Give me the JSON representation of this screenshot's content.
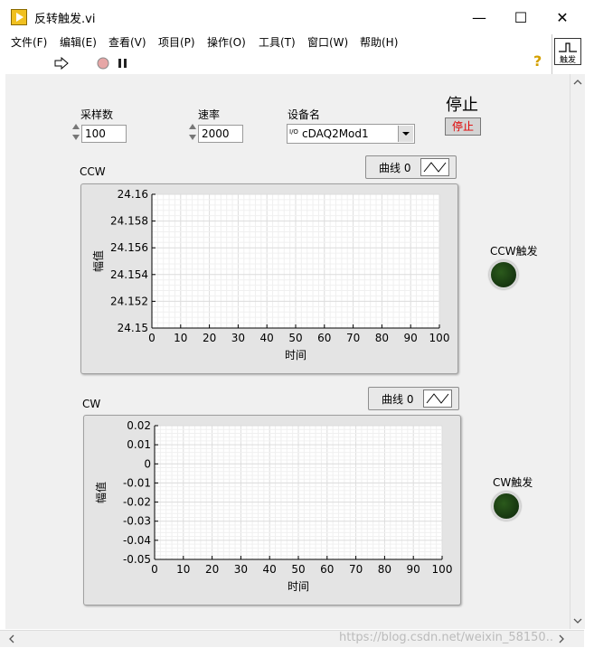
{
  "window": {
    "title": "反转触发.vi",
    "minimize": "—",
    "maximize": "☐",
    "close": "✕"
  },
  "menu": [
    "文件(F)",
    "编辑(E)",
    "查看(V)",
    "项目(P)",
    "操作(O)",
    "工具(T)",
    "窗口(W)",
    "帮助(H)"
  ],
  "toolbar": {
    "help": "?",
    "connector_label": "触发"
  },
  "controls": {
    "samples": {
      "label": "采样数",
      "value": "100"
    },
    "rate": {
      "label": "速率",
      "value": "2000"
    },
    "device": {
      "label": "设备名",
      "prefix": "I/O",
      "value": "cDAQ2Mod1"
    },
    "stop": {
      "label": "停止",
      "button": "停止"
    }
  },
  "leds": {
    "ccw": "CCW触发",
    "cw": "CW触发",
    "ccw_on": false,
    "cw_on": false
  },
  "watermark": "https://blog.csdn.net/weixin_58150..",
  "chart_data": [
    {
      "type": "line",
      "title": "CCW",
      "legend": "曲线 0",
      "xlabel": "时间",
      "ylabel": "幅值",
      "xlim": [
        0,
        100
      ],
      "ylim": [
        24.15,
        24.16
      ],
      "x_ticks": [
        "0",
        "10",
        "20",
        "30",
        "40",
        "50",
        "60",
        "70",
        "80",
        "90",
        "100"
      ],
      "y_ticks": [
        "24.16",
        "24.158",
        "24.156",
        "24.154",
        "24.152",
        "24.15"
      ],
      "grid": true,
      "series": []
    },
    {
      "type": "line",
      "title": "CW",
      "legend": "曲线 0",
      "xlabel": "时间",
      "ylabel": "幅值",
      "xlim": [
        0,
        100
      ],
      "ylim": [
        -0.05,
        0.02
      ],
      "x_ticks": [
        "0",
        "10",
        "20",
        "30",
        "40",
        "50",
        "60",
        "70",
        "80",
        "90",
        "100"
      ],
      "y_ticks": [
        "0.02",
        "0.01",
        "0",
        "-0.01",
        "-0.02",
        "-0.03",
        "-0.04",
        "-0.05"
      ],
      "grid": true,
      "series": []
    }
  ]
}
